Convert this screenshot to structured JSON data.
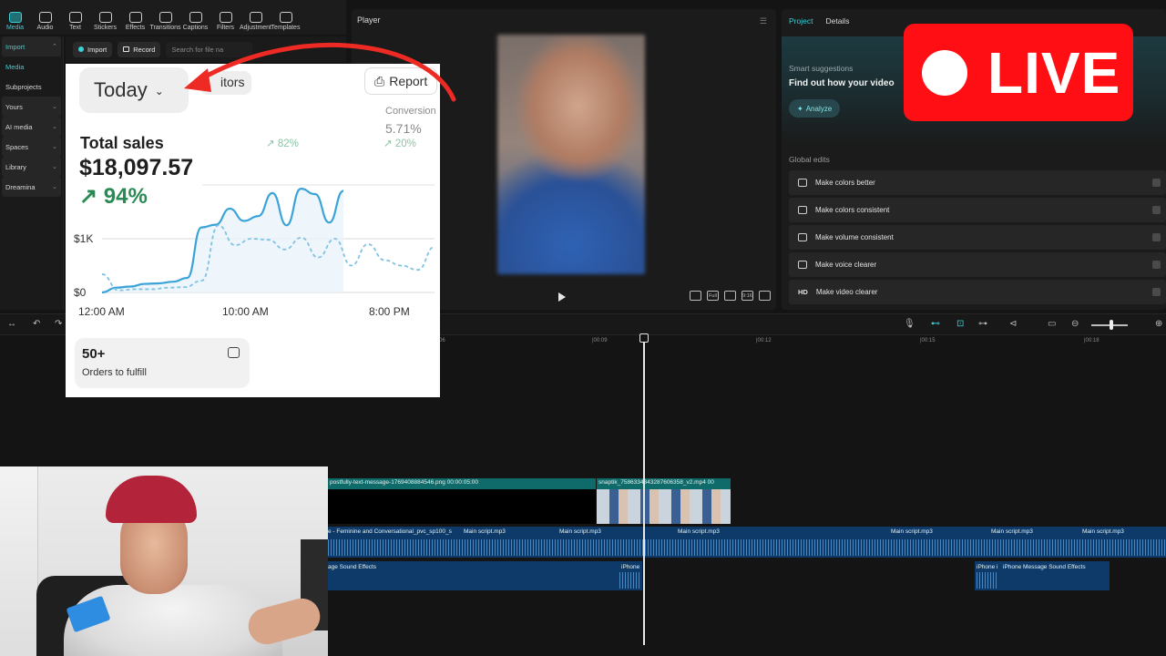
{
  "toolbar": {
    "tools": [
      {
        "label": "Media",
        "icon": "media-icon",
        "active": true
      },
      {
        "label": "Audio",
        "icon": "audio-icon"
      },
      {
        "label": "Text",
        "icon": "text-icon"
      },
      {
        "label": "Stickers",
        "icon": "stickers-icon"
      },
      {
        "label": "Effects",
        "icon": "effects-icon"
      },
      {
        "label": "Transitions",
        "icon": "transitions-icon"
      },
      {
        "label": "Captions",
        "icon": "captions-icon"
      },
      {
        "label": "Filters",
        "icon": "filters-icon"
      },
      {
        "label": "Adjustment",
        "icon": "adjustment-icon"
      },
      {
        "label": "Templates",
        "icon": "templates-icon"
      }
    ]
  },
  "sidebar": {
    "items": [
      {
        "label": "Import",
        "active": true,
        "boxed": true
      },
      {
        "label": "Media",
        "active": true
      },
      {
        "label": "Subprojects"
      },
      {
        "label": "Yours",
        "boxed": true
      },
      {
        "label": "AI media",
        "boxed": true
      },
      {
        "label": "Spaces",
        "boxed": true
      },
      {
        "label": "Library",
        "boxed": true
      },
      {
        "label": "Dreamina",
        "boxed": true
      }
    ]
  },
  "media_bar": {
    "import_label": "Import",
    "record_label": "Record",
    "search_placeholder": "Search for file na"
  },
  "player": {
    "title": "Player",
    "ctrl_labels": [
      "",
      "Full",
      "",
      "9:16",
      ""
    ]
  },
  "right_panel": {
    "tabs": [
      "Project",
      "Details"
    ],
    "smart_label": "Smart suggestions",
    "smart_title": "Find out how your video",
    "analyze_label": "Analyze",
    "global_label": "Global edits",
    "edits": [
      {
        "label": "Make colors better",
        "icon": "magic-wand-icon"
      },
      {
        "label": "Make colors consistent",
        "icon": "palette-icon"
      },
      {
        "label": "Make volume consistent",
        "icon": "sliders-icon"
      },
      {
        "label": "Make voice clearer",
        "icon": "waveform-icon"
      },
      {
        "label": "Make video clearer",
        "icon": "hd-icon",
        "badge": "HD"
      }
    ]
  },
  "live_badge": {
    "text": "LIVE",
    "color": "#ff0e14"
  },
  "timeline": {
    "ruler": [
      "06",
      "|00:09",
      "|00:12",
      "|00:15",
      "|00:18"
    ],
    "text_clip": "postfully-text-message-1769408884546.png  00:00:05:00",
    "video_clip": "snaptik_7586334343287606358_v2.mp4  00",
    "audio_clips": [
      "e - Feminine and Conversational_pvc_sp100_s",
      "Main script.mp3",
      "Main script.mp3",
      "Main script.mp3",
      "Main script.mp3",
      "Main script.mp3",
      "Main script.mp3"
    ],
    "sfx_clips": [
      "age Sound Effects",
      "iPhone",
      "iPhone i",
      "iPhone Message Sound Effects"
    ]
  },
  "sales_card": {
    "period": "Today",
    "tab_partial": "itors",
    "report_label": "Report",
    "conversion_label": "Conversion",
    "conversion_value": "5.71%",
    "conversion_change": "↗ 20%",
    "mid_change": "↗ 82%",
    "total_label": "Total sales",
    "total_value": "$18,097.57",
    "total_change": "↗ 94%",
    "orders_count": "50+",
    "orders_label": "Orders to fulfill",
    "accent": "#2a8a53"
  },
  "chart_data": {
    "type": "line",
    "x_ticks": [
      "12:00 AM",
      "10:00 AM",
      "8:00 PM"
    ],
    "y_ticks": [
      "$0",
      "$1K"
    ],
    "ylim": [
      0,
      2000
    ],
    "series": [
      {
        "style": "solid",
        "color": "#3aa3d8",
        "values": [
          0,
          90,
          110,
          160,
          170,
          200,
          270,
          1210,
          1260,
          1560,
          1330,
          1420,
          1850,
          1250,
          1930,
          1830,
          1300,
          1890
        ]
      },
      {
        "style": "dashed",
        "color": "#7fc3e4",
        "values": [
          340,
          40,
          60,
          60,
          90,
          100,
          220,
          1250,
          880,
          1000,
          980,
          800,
          1020,
          650,
          1000,
          500,
          900,
          600,
          500,
          420,
          850
        ]
      }
    ],
    "grid": true
  }
}
